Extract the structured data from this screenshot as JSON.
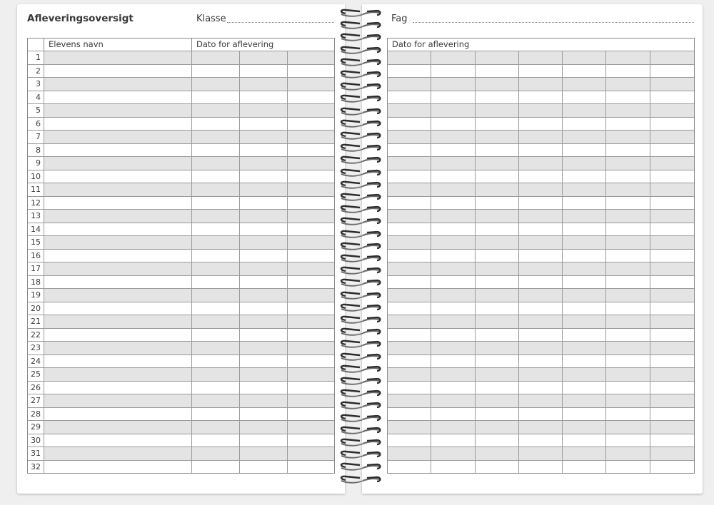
{
  "left_page": {
    "title": "Afleveringsoversigt",
    "class_label": "Klasse",
    "table": {
      "col_name_header": "Elevens navn",
      "col_date_header": "Dato for aflevering",
      "row_numbers": [
        "1",
        "2",
        "3",
        "4",
        "5",
        "6",
        "7",
        "8",
        "9",
        "10",
        "11",
        "12",
        "13",
        "14",
        "15",
        "16",
        "17",
        "18",
        "19",
        "20",
        "21",
        "22",
        "23",
        "24",
        "25",
        "26",
        "27",
        "28",
        "29",
        "30",
        "31",
        "32"
      ]
    }
  },
  "right_page": {
    "subject_label": "Fag",
    "table": {
      "col_date_header": "Dato for aflevering",
      "date_columns": 7
    }
  },
  "colors": {
    "shade": "#e4e4e4",
    "border": "#8a8a8a",
    "text": "#3a3a3a"
  },
  "icons": [
    "spiral-binding-icon"
  ]
}
